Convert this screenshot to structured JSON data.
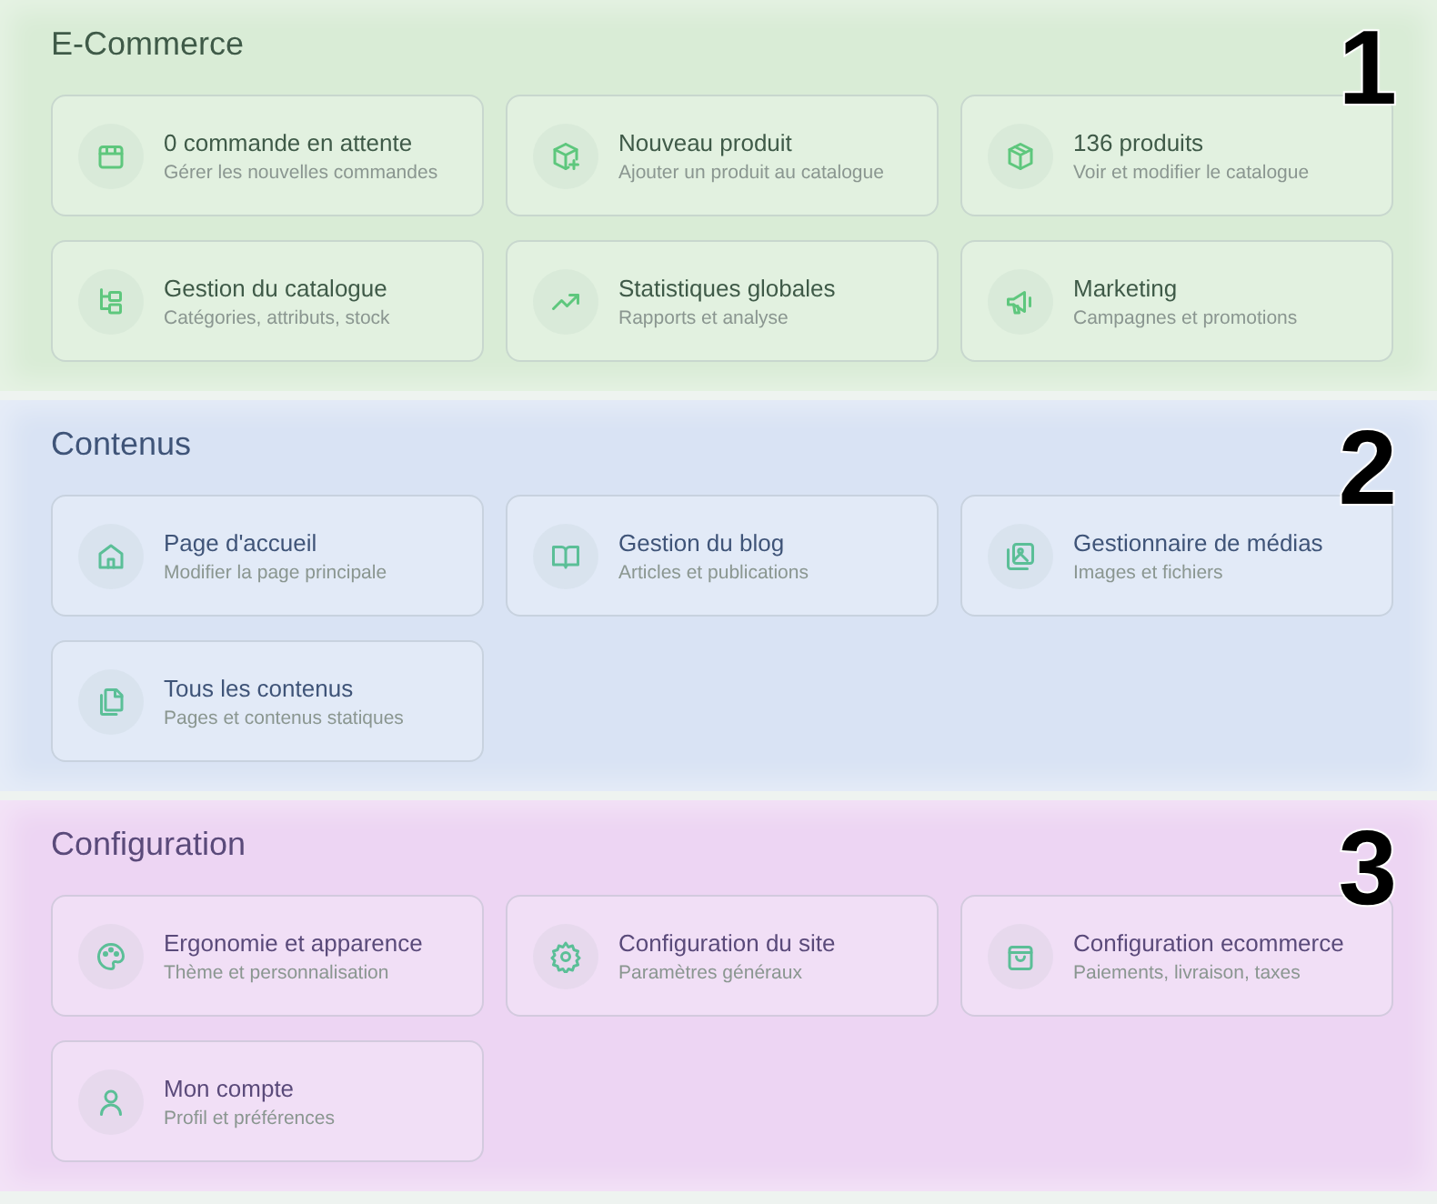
{
  "sections": [
    {
      "title": "E-Commerce",
      "number": "1",
      "color": "#d9ecd6",
      "cards": [
        {
          "title": "0 commande en attente",
          "subtitle": "Gérer les nouvelles commandes"
        },
        {
          "title": "Nouveau produit",
          "subtitle": "Ajouter un produit au catalogue"
        },
        {
          "title": "136 produits",
          "subtitle": "Voir et modifier le catalogue"
        },
        {
          "title": "Gestion du catalogue",
          "subtitle": "Catégories, attributs, stock"
        },
        {
          "title": "Statistiques globales",
          "subtitle": "Rapports et analyse"
        },
        {
          "title": "Marketing",
          "subtitle": "Campagnes et promotions"
        }
      ]
    },
    {
      "title": "Contenus",
      "number": "2",
      "color": "#d9e3f4",
      "cards": [
        {
          "title": "Page d'accueil",
          "subtitle": "Modifier la page principale"
        },
        {
          "title": "Gestion du blog",
          "subtitle": "Articles et publications"
        },
        {
          "title": "Gestionnaire de médias",
          "subtitle": "Images et fichiers"
        },
        {
          "title": "Tous les contenus",
          "subtitle": "Pages et contenus statiques"
        }
      ]
    },
    {
      "title": "Configuration",
      "number": "3",
      "color": "#edd5f3",
      "cards": [
        {
          "title": "Ergonomie et apparence",
          "subtitle": "Thème et personnalisation"
        },
        {
          "title": "Configuration du site",
          "subtitle": "Paramètres généraux"
        },
        {
          "title": "Configuration ecommerce",
          "subtitle": "Paiements, livraison, taxes"
        },
        {
          "title": "Mon compte",
          "subtitle": "Profil et préférences"
        }
      ]
    }
  ]
}
